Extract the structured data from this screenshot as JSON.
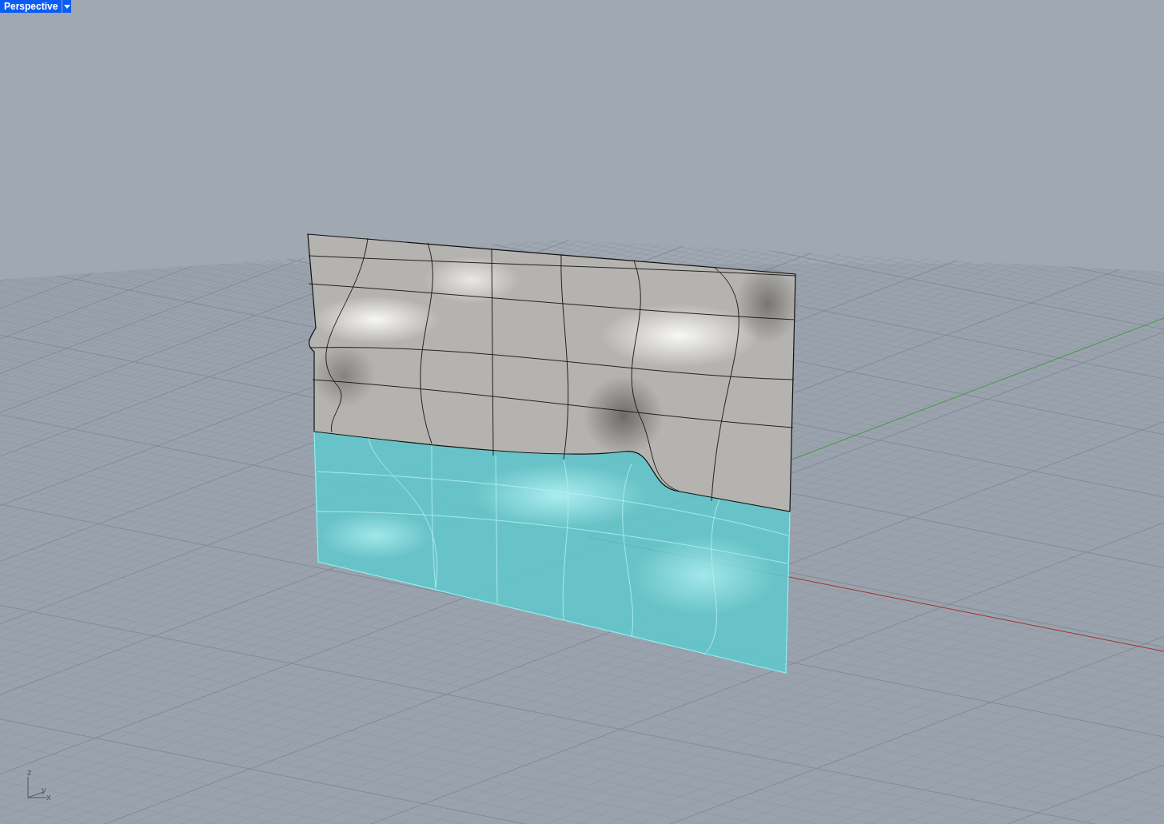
{
  "viewport": {
    "title": "Perspective",
    "axis_labels": [
      {
        "text": "z"
      },
      {
        "text": "y"
      },
      {
        "text": "x"
      }
    ]
  }
}
